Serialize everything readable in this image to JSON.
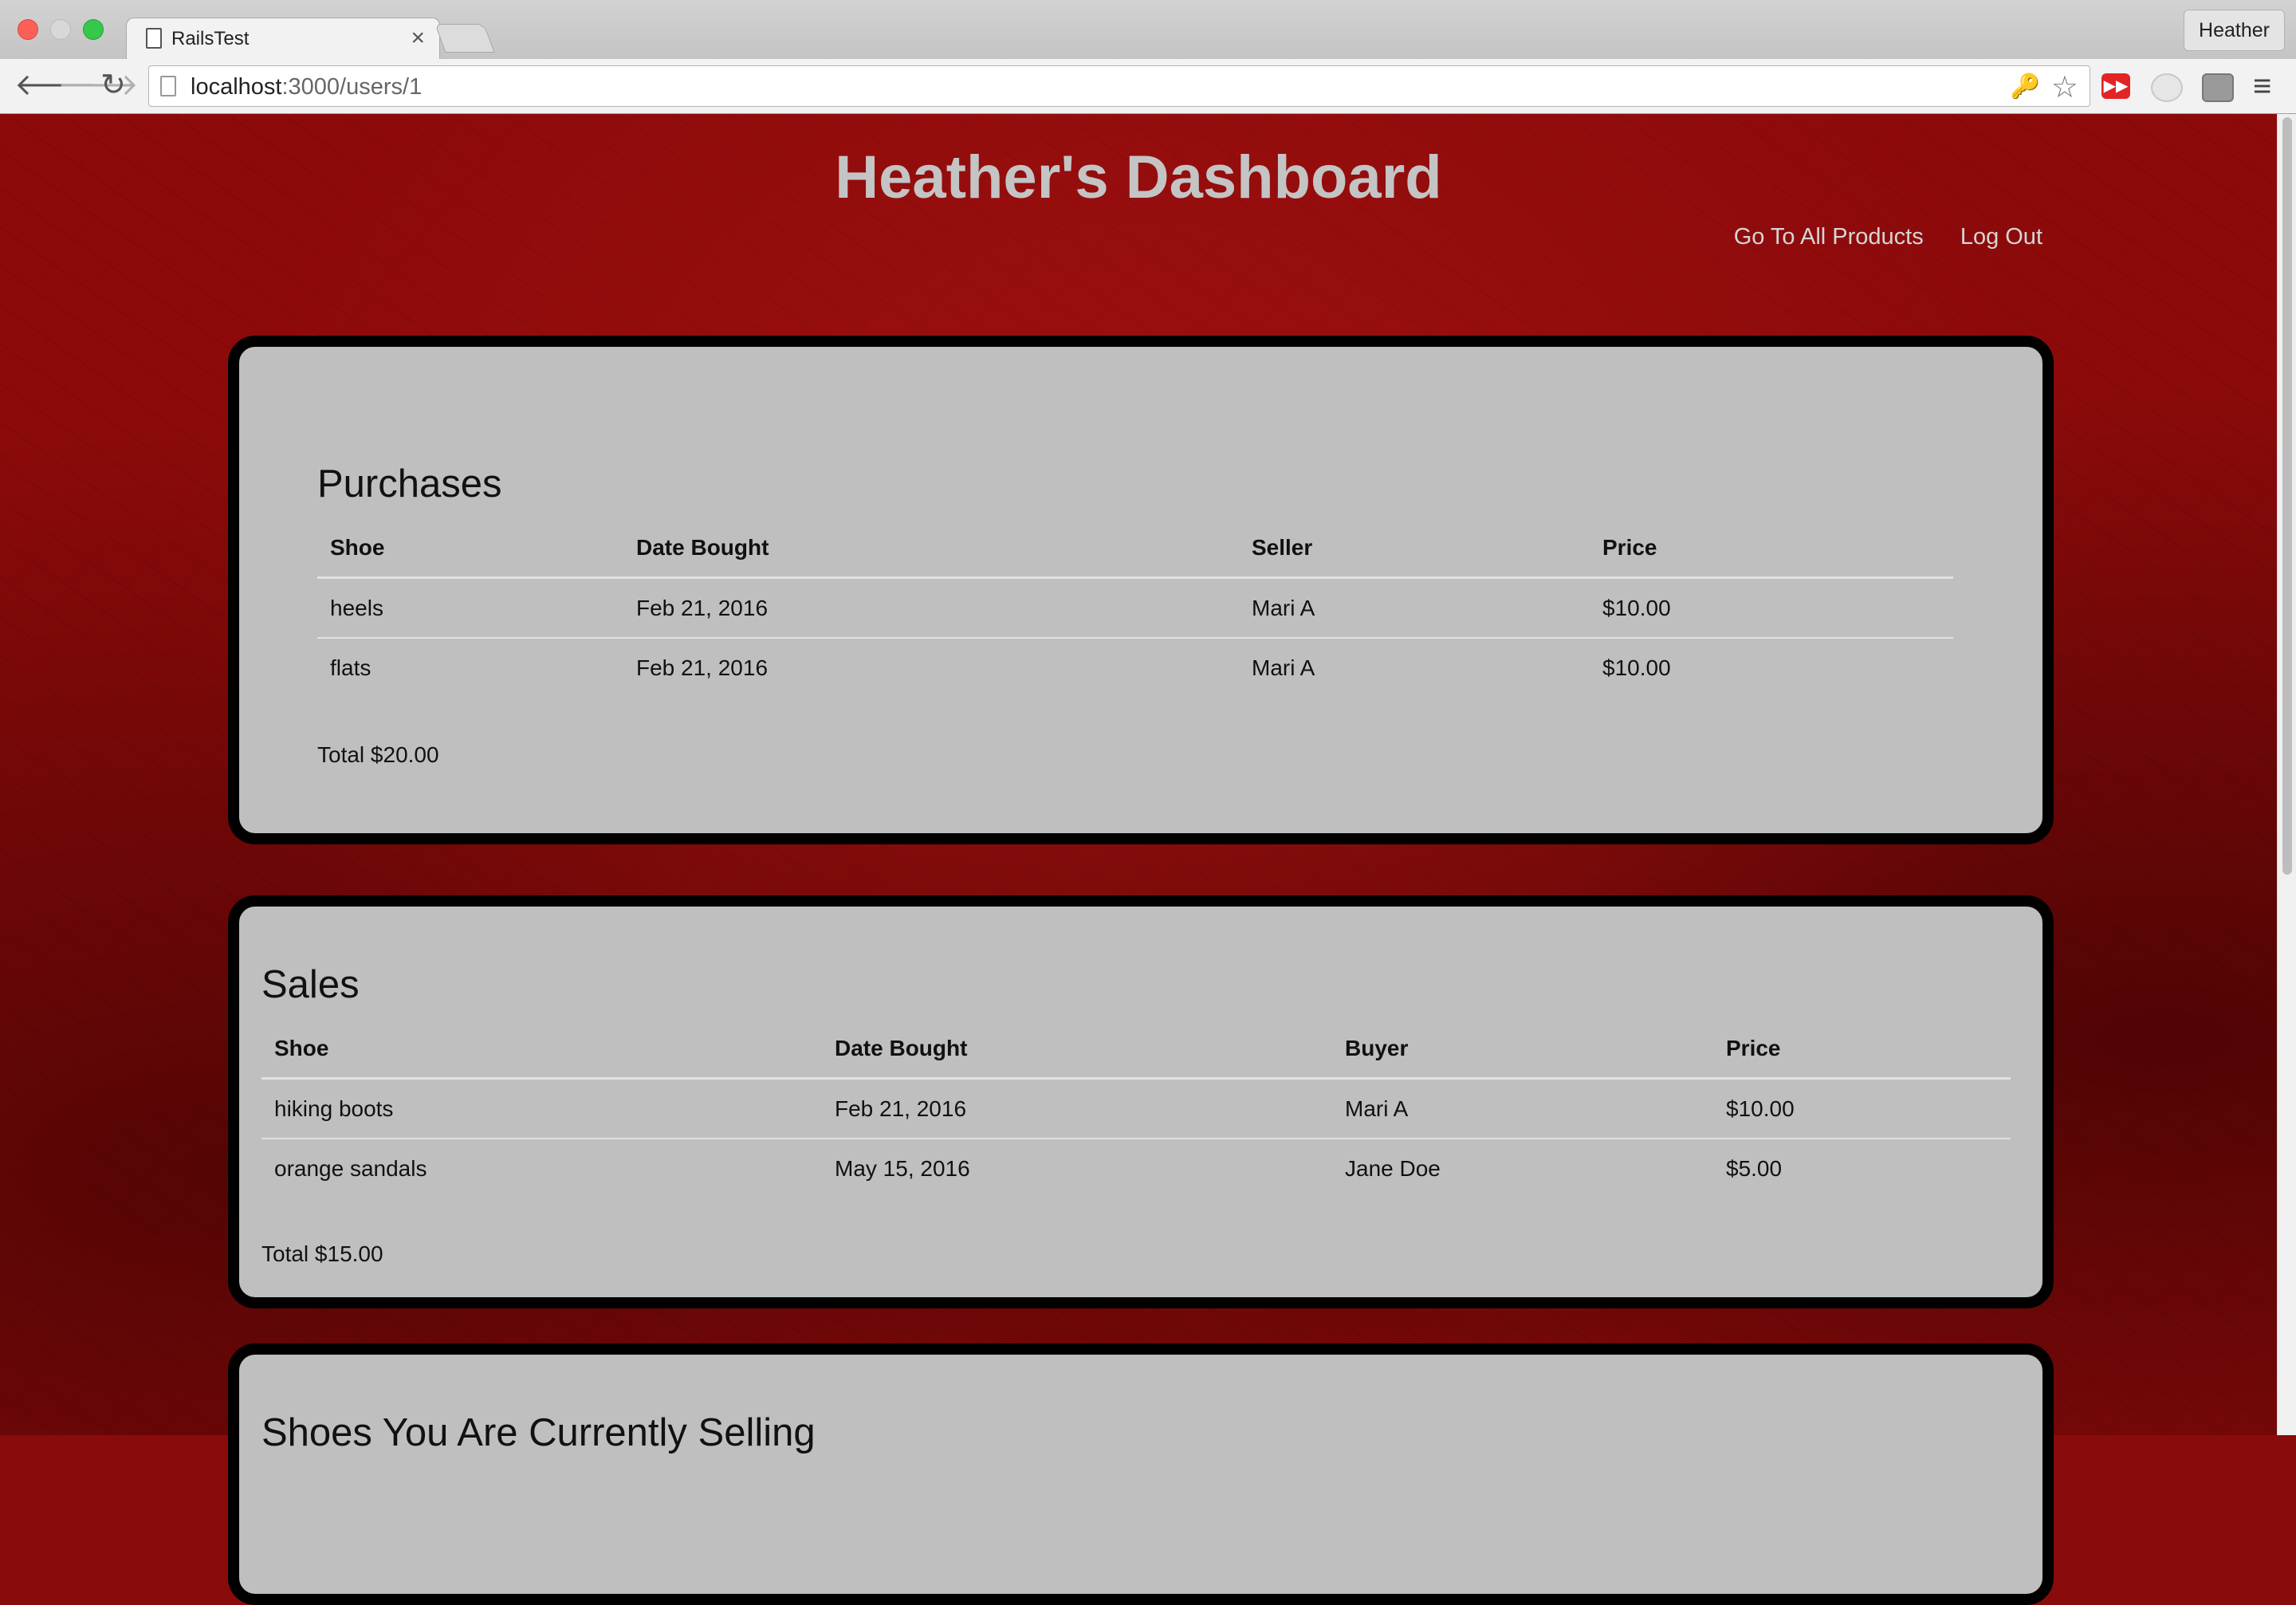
{
  "browser": {
    "tab_title": "RailsTest",
    "tab_close": "×",
    "profile_name": "Heather",
    "url_host": "localhost",
    "url_rest": ":3000/users/1",
    "youtube_glyph": "▶▶"
  },
  "header": {
    "title": "Heather's Dashboard",
    "nav": {
      "all_products": "Go To All Products",
      "log_out": "Log Out"
    }
  },
  "purchases": {
    "heading": "Purchases",
    "columns": [
      "Shoe",
      "Date Bought",
      "Seller",
      "Price"
    ],
    "rows": [
      [
        "heels",
        "Feb 21, 2016",
        "Mari A",
        "$10.00"
      ],
      [
        "flats",
        "Feb 21, 2016",
        "Mari A",
        "$10.00"
      ]
    ],
    "total": "Total $20.00"
  },
  "sales": {
    "heading": "Sales",
    "columns": [
      "Shoe",
      "Date Bought",
      "Buyer",
      "Price"
    ],
    "rows": [
      [
        "hiking boots",
        "Feb 21, 2016",
        "Mari A",
        "$10.00"
      ],
      [
        "orange sandals",
        "May 15, 2016",
        "Jane Doe",
        "$5.00"
      ]
    ],
    "total": "Total $15.00"
  },
  "current": {
    "heading": "Shoes You Are Currently Selling"
  }
}
